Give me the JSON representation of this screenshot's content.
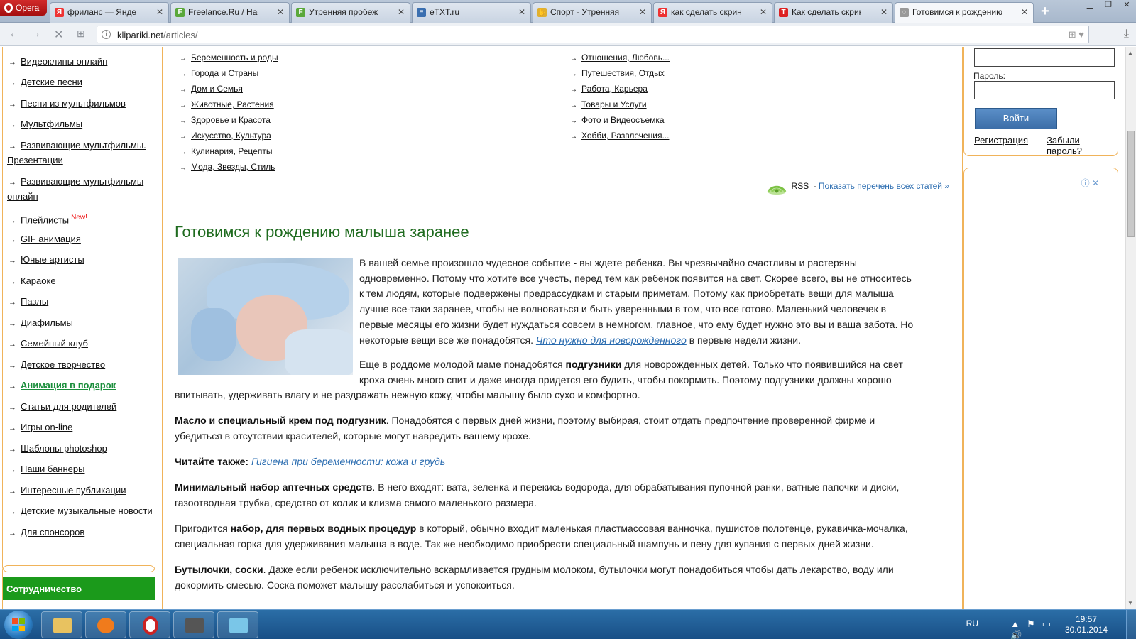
{
  "browser": {
    "menu_label": "Opera",
    "tabs": [
      {
        "title": "фриланс — Яндекс: нашлось",
        "favicon": "Я",
        "favicon_color": "#e33"
      },
      {
        "title": "Freelance.Ru / Настройки",
        "favicon": "F",
        "favicon_color": "#5aa83a"
      },
      {
        "title": "Утренняя пробежка и",
        "favicon": "F",
        "favicon_color": "#5aa83a"
      },
      {
        "title": "eTXT.ru",
        "favicon": "≡",
        "favicon_color": "#3a6fb0"
      },
      {
        "title": "Спорт - Утренняя пробежка",
        "favicon": "✋",
        "favicon_color": "#e0b030"
      },
      {
        "title": "как сделать скриншот",
        "favicon": "Я",
        "favicon_color": "#e33"
      },
      {
        "title": "Как сделать скриншот",
        "favicon": "T",
        "favicon_color": "#d22"
      },
      {
        "title": "Готовимся к рождению",
        "favicon": "◌",
        "favicon_color": "#888"
      }
    ],
    "new_tab_label": "+",
    "url_host": "klipariki.net",
    "url_path": "/articles/"
  },
  "left_menu": {
    "items": [
      {
        "label": "Видеоклипы онлайн"
      },
      {
        "label": "Детские песни"
      },
      {
        "label": "Песни из мультфильмов"
      },
      {
        "label": "Мультфильмы"
      },
      {
        "label": "Развивающие мультфильмы.",
        "label2": "Презентации"
      },
      {
        "label": "Развивающие мультфильмы",
        "label2": "онлайн"
      },
      {
        "label": "Плейлисты",
        "badge": "New!"
      },
      {
        "label": "GIF анимация"
      },
      {
        "label": "Юные артисты"
      },
      {
        "label": "Караоке"
      },
      {
        "label": "Пазлы"
      },
      {
        "label": "Диафильмы"
      },
      {
        "label": "Семейный клуб"
      },
      {
        "label": "Детское творчество"
      },
      {
        "label": "Анимация в подарок",
        "highlight": true
      },
      {
        "label": "Статьи для родителей"
      },
      {
        "label": "Игры on-line"
      },
      {
        "label": "Шаблоны photoshop"
      },
      {
        "label": "Наши баннеры"
      },
      {
        "label": "Интересные публикации"
      },
      {
        "label": "Детские музыкальные новости"
      },
      {
        "label": "Для спонсоров"
      }
    ],
    "coop_title": "Сотрудничество"
  },
  "categories": {
    "col1": [
      "Беременность и роды",
      "Города и Страны",
      "Дом и Семья",
      "Животные, Растения",
      "Здоровье и Красота",
      "Искусство, Культура",
      "Кулинария, Рецепты",
      "Мода, Звезды, Стиль"
    ],
    "col2": [
      "Отношения, Любовь...",
      "Путешествия, Отдых",
      "Работа, Карьера",
      "Товары и Услуги",
      "Фото и Видеосъемка",
      "Хобби, Развлечения..."
    ]
  },
  "rss": {
    "label": "RSS",
    "sep": " - ",
    "show_all": "Показать перечень всех статей »"
  },
  "article": {
    "title": "Готовимся к рождению малыша заранее",
    "p1_lines": [
      "В вашей семье произошло чудесное событие - вы ждете ребенка. Вы чрезвычайно счастливы и растеряны",
      "одновременно. Потому что хотите все учесть, перед тем как ребенок появится на свет. Скорее всего, вы не относитесь",
      "к тем людям, которые подвержены предрассудкам и старым приметам. Потому как приобретать вещи для малыша",
      "лучше все-таки заранее, чтобы не волноваться и быть уверенными в том, что все готово. Маленький человечек в",
      "первые месяцы его жизни будет нуждаться совсем в немногом, главное, что ему будет нужно это вы и ваша забота. Но"
    ],
    "p1_last_pre": "некоторые вещи все же понадобятся. ",
    "p1_link": "Что нужно для новорожденного",
    "p1_last_post": " в первые недели жизни.",
    "p2_pre": "Еще в роддоме молодой маме понадобятся ",
    "p2_bold": "подгузники",
    "p2_post": " для новорожденных детей. Только что появившийся на свет",
    "p2_line2": "кроха очень много спит и даже иногда придется его будить, чтобы покормить. Поэтому подгузники должны хорошо",
    "p2_line3": "впитывать, удерживать влагу и не раздражать нежную кожу, чтобы малышу было сухо и комфортно.",
    "p3_bold": "Масло и специальный крем под подгузник",
    "p3_post": ". Понадобятся с первых дней жизни, поэтому выбирая, стоит отдать предпочтение проверенной фирме и",
    "p3_line2": "убедиться в отсутствии красителей, которые могут навредить вашему крохе.",
    "p4_bold": "Читайте также:",
    "p4_link": "Гигиена при беременности: кожа и грудь",
    "p5_bold": "Минимальный набор аптечных средств",
    "p5_post": ". В него входят: вата, зеленка и перекись водорода, для обрабатывания пупочной ранки, ватные папочки и диски,",
    "p5_line2": "газоотводная трубка, средство от колик и клизма самого маленького размера.",
    "p6_pre": "Пригодится ",
    "p6_bold": "набор, для первых водных процедур",
    "p6_post": " в который, обычно входит маленькая пластмассовая ванночка, пушистое полотенце, рукавичка-мочалка,",
    "p6_line2": "специальная горка для удерживания малыша в воде. Так же необходимо приобрести специальный шампунь и пену для купания с первых дней жизни.",
    "p7_bold": "Бутылочки, соски",
    "p7_post": ". Даже если ребенок исключительно вскармливается грудным молоком, бутылочки могут понадобиться чтобы дать лекарство, воду или",
    "p7_line2": "докормить смесью. Соска поможет малышу расслабиться и успокоиться."
  },
  "login": {
    "password_label": "Пароль:",
    "submit_label": "Войти",
    "register_label": "Регистрация",
    "forgot_label": "Забыли пароль?"
  },
  "taskbar": {
    "lang": "RU",
    "time": "19:57",
    "date": "30.01.2014"
  },
  "colors": {
    "accent_border": "#f0b35a",
    "title_green": "#1f6b1f",
    "link_blue": "#2a6cb0",
    "coop_green": "#1b9a1b"
  }
}
